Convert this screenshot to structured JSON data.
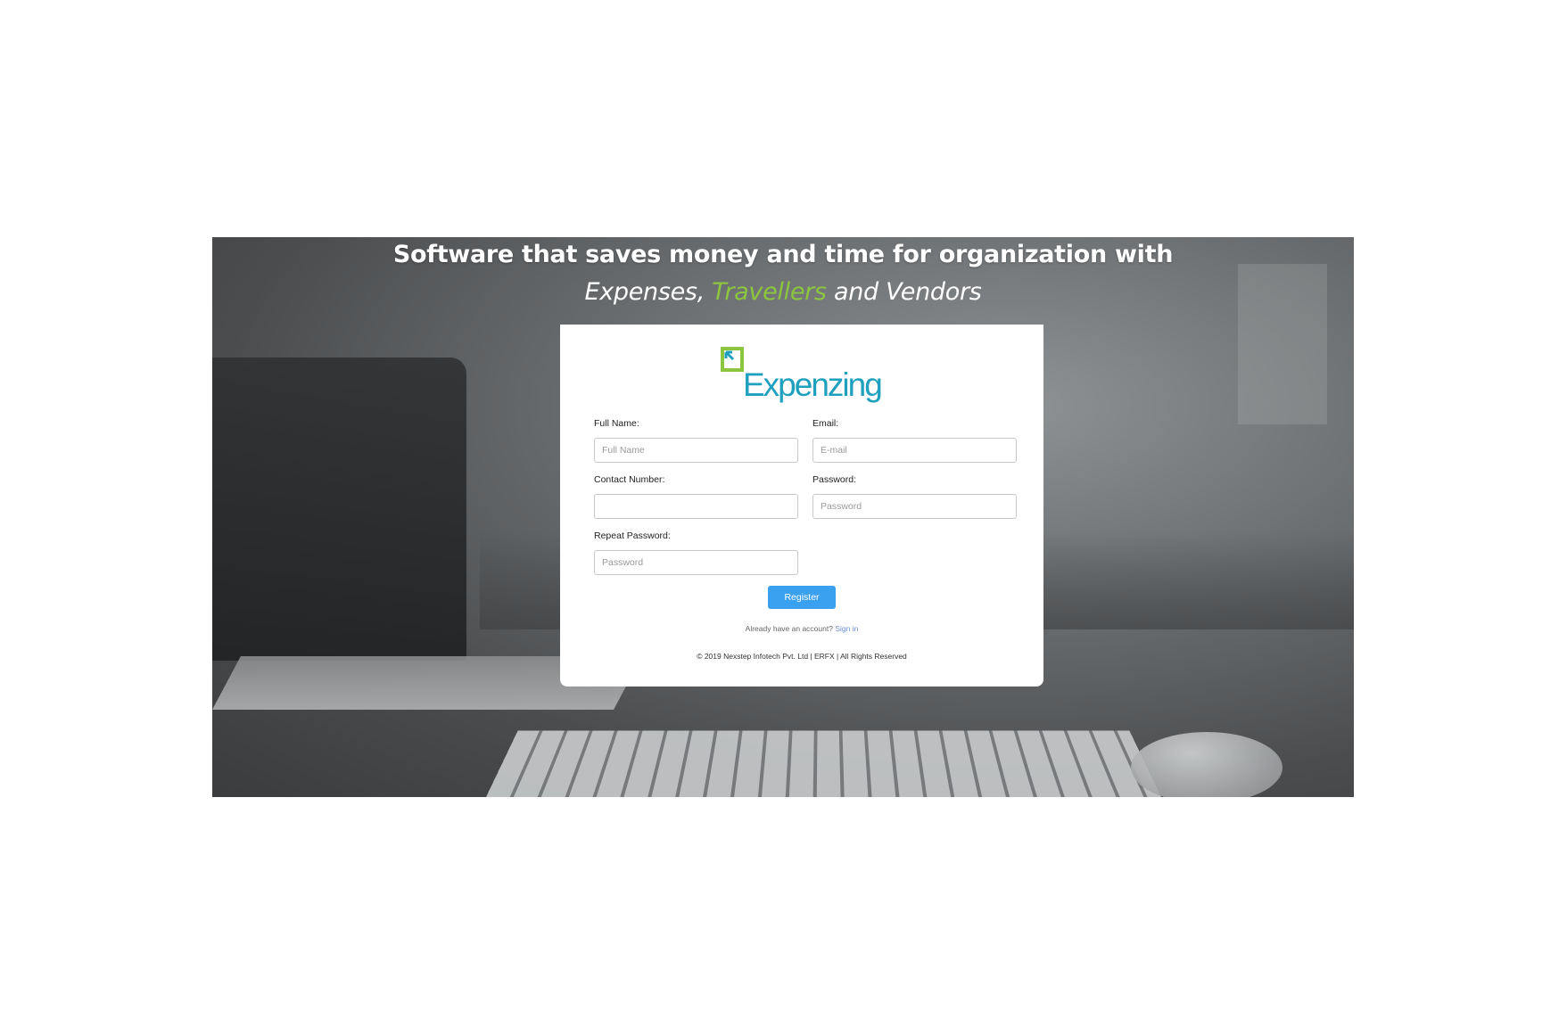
{
  "hero": {
    "headline": "Software that saves money and time for organization with",
    "sub_part1": "Expenses,",
    "sub_highlight": "Travellers",
    "sub_part2": "and Vendors",
    "highlight_color": "#8cc63f"
  },
  "logo": {
    "text": "Expenzing",
    "brand_color": "#1fa0bf",
    "mark_color": "#8cc63f"
  },
  "form": {
    "full_name_label": "Full Name:",
    "full_name_placeholder": "Full Name",
    "email_label": "Email:",
    "email_placeholder": "E-mail",
    "contact_label": "Contact Number:",
    "contact_placeholder": "",
    "password_label": "Password:",
    "password_placeholder": "Password",
    "repeat_label": "Repeat Password:",
    "repeat_placeholder": "Password",
    "register_label": "Register",
    "register_color": "#3aa0f0"
  },
  "footer": {
    "account_text": "Already have an account?",
    "signin_label": "Sign in",
    "copyright": "© 2019 Nexstep Infotech Pvt. Ltd | ERFX | All Rights Reserved"
  }
}
